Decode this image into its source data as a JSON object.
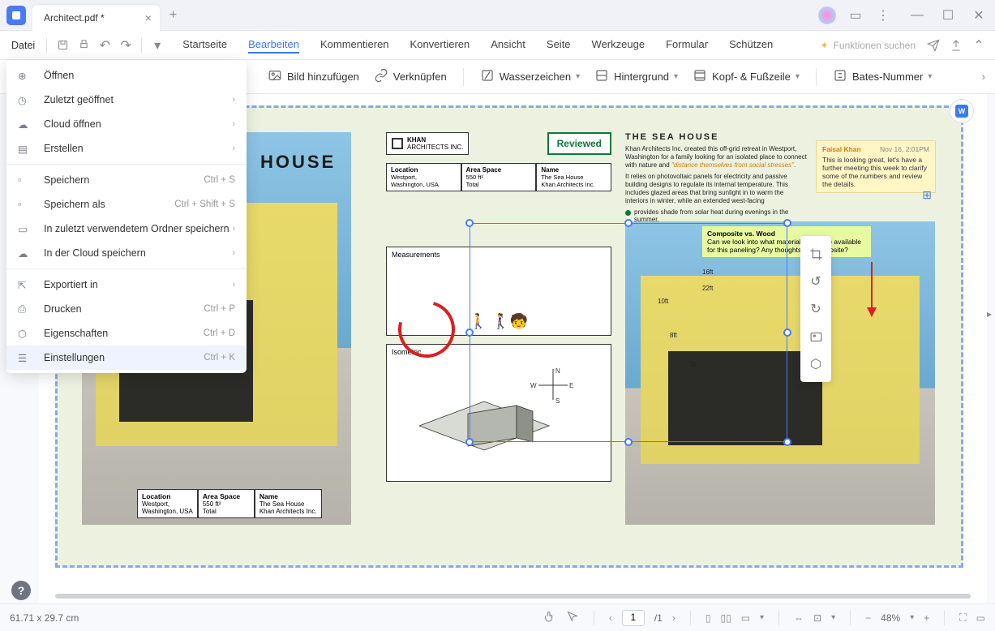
{
  "tab": {
    "title": "Architect.pdf *"
  },
  "menubar": {
    "file": "Datei",
    "tabs": [
      "Startseite",
      "Bearbeiten",
      "Kommentieren",
      "Konvertieren",
      "Ansicht",
      "Seite",
      "Werkzeuge",
      "Formular",
      "Schützen"
    ],
    "active_tab": "Bearbeiten",
    "search_placeholder": "Funktionen suchen"
  },
  "toolbar": {
    "items": {
      "image": "Bild hinzufügen",
      "link": "Verknüpfen",
      "watermark": "Wasserzeichen",
      "background": "Hintergrund",
      "headerfooter": "Kopf- & Fußzeile",
      "bates": "Bates-Nummer"
    }
  },
  "file_menu": {
    "open": "Öffnen",
    "recent": "Zuletzt geöffnet",
    "cloud_open": "Cloud öffnen",
    "create": "Erstellen",
    "save": "Speichern",
    "save_as": "Speichern als",
    "save_last_folder": "In zuletzt verwendetem Ordner speichern",
    "save_cloud": "In der Cloud speichern",
    "export": "Exportiert in",
    "print": "Drucken",
    "properties": "Eigenschaften",
    "settings": "Einstellungen",
    "sc_save": "Ctrl + S",
    "sc_save_as": "Ctrl + Shift + S",
    "sc_print": "Ctrl + P",
    "sc_props": "Ctrl + D",
    "sc_settings": "Ctrl + K"
  },
  "doc": {
    "house_title": "HOUSE",
    "tbl": {
      "loc_h": "Location",
      "loc_v1": "Westport,",
      "loc_v2": "Washington, USA",
      "area_h": "Area Space",
      "area_v1": "550 ft²",
      "area_v2": "Total",
      "name_h": "Name",
      "name_v1": "The Sea House",
      "name_v2": "Khan Architects Inc."
    },
    "logo_text": "KHAN\nARCHITECTS INC.",
    "reviewed": "Reviewed",
    "measurements": "Measurements",
    "isometric": "Isometric",
    "compass": {
      "n": "N",
      "e": "E",
      "s": "S",
      "w": "W"
    },
    "sea_title": "THE SEA HOUSE",
    "p1a": "Khan Architects Inc. created this off-grid retreat in Westport, Washington for a family looking for an isolated place to connect with nature and ",
    "p1b": "\"distance themselves from social stresses\"",
    "p1c": ".",
    "p2": "It relies on photovoltaic panels for electricity and passive building designs to regulate its internal temperature. This includes glazed areas that bring sunlight in to warm the interiors in winter, while an extended west-facing",
    "p2b": "provides shade from solar heat during evenings in the summer.",
    "sticky": {
      "who": "Faisal Khan",
      "when": "Nov 16, 2:01PM",
      "body": "This is looking great, let's have a further meeting this week to clarify some of the numbers and review the details."
    },
    "note2": {
      "title": "Composite vs. Wood",
      "body": "Can we look into what materials we have available for this paneling? Any thoughts on composite?"
    },
    "m": {
      "a": "16ft",
      "b": "22ft",
      "c": "10ft",
      "d": "8ft",
      "e": "7ft"
    }
  },
  "statusbar": {
    "dims": "61.71 x 29.7 cm",
    "page": "1",
    "pages": "/1",
    "zoom": "48%"
  }
}
